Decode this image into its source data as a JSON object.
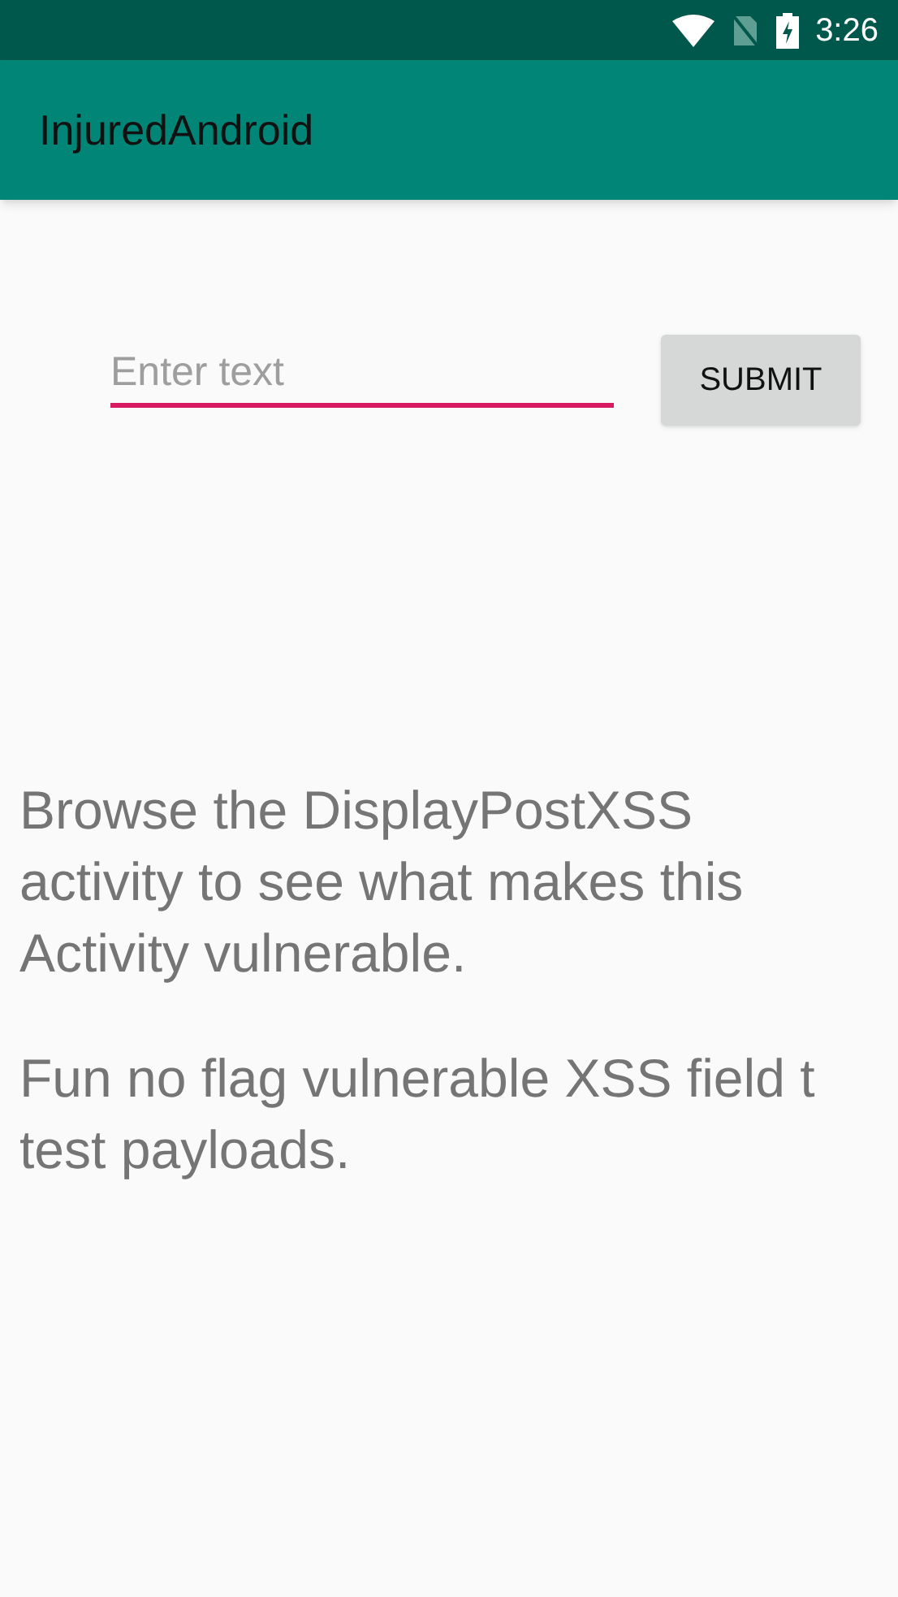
{
  "status_bar": {
    "time": "3:26"
  },
  "app_bar": {
    "title": "InjuredAndroid"
  },
  "form": {
    "placeholder": "Enter text",
    "button": "SUBMIT"
  },
  "paragraphs": [
    {
      "lines": [
        "Browse the DisplayPostXSS",
        "activity to see what makes this",
        "Activity vulnerable."
      ]
    },
    {
      "lines": [
        "Fun no flag vulnerable XSS field t",
        "test payloads."
      ]
    }
  ]
}
